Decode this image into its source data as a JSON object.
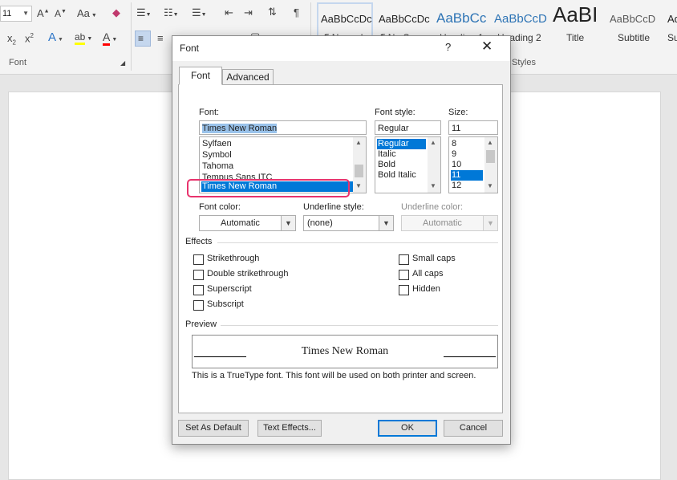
{
  "ribbon": {
    "font_size_value": "11",
    "font_group_label": "Font",
    "styles_group_label": "Styles",
    "aa_label": "Aa",
    "styles": [
      {
        "preview": "AaBbCcDc",
        "name": "¶ Normal"
      },
      {
        "preview": "AaBbCcDc",
        "name": "¶ No Spac..."
      },
      {
        "preview": "AaBbCc",
        "name": "Heading 1"
      },
      {
        "preview": "AaBbCcD",
        "name": "Heading 2"
      },
      {
        "preview": "AaBI",
        "name": "Title"
      },
      {
        "preview": "AaBbCcD",
        "name": "Subtitle"
      },
      {
        "preview": "Ad",
        "name": "Su"
      }
    ],
    "colors": {
      "highlight": "#ffff00",
      "font_color": "#ff0000",
      "accent": "#2b579a"
    }
  },
  "dialog": {
    "title": "Font",
    "help": "?",
    "close": "✕",
    "tabs": [
      "Font",
      "Advanced"
    ],
    "font_label": "Font:",
    "font_value": "Times New Roman",
    "font_list": [
      "Sylfaen",
      "Symbol",
      "Tahoma",
      "Tempus Sans ITC",
      "Times New Roman"
    ],
    "font_style_label": "Font style:",
    "font_style_value": "Regular",
    "font_style_list": [
      "Regular",
      "Italic",
      "Bold",
      "Bold Italic"
    ],
    "size_label": "Size:",
    "size_value": "11",
    "size_list": [
      "8",
      "9",
      "10",
      "11",
      "12"
    ],
    "font_color_label": "Font color:",
    "font_color_value": "Automatic",
    "underline_style_label": "Underline style:",
    "underline_style_value": "(none)",
    "underline_color_label": "Underline color:",
    "underline_color_value": "Automatic",
    "effects_label": "Effects",
    "effects_left": [
      "Strikethrough",
      "Double strikethrough",
      "Superscript",
      "Subscript"
    ],
    "effects_right": [
      "Small caps",
      "All caps",
      "Hidden"
    ],
    "preview_label": "Preview",
    "preview_text": "Times New Roman",
    "note": "This is a TrueType font. This font will be used on both printer and screen.",
    "buttons": {
      "set_default": "Set As Default",
      "text_effects": "Text Effects...",
      "ok": "OK",
      "cancel": "Cancel"
    }
  }
}
